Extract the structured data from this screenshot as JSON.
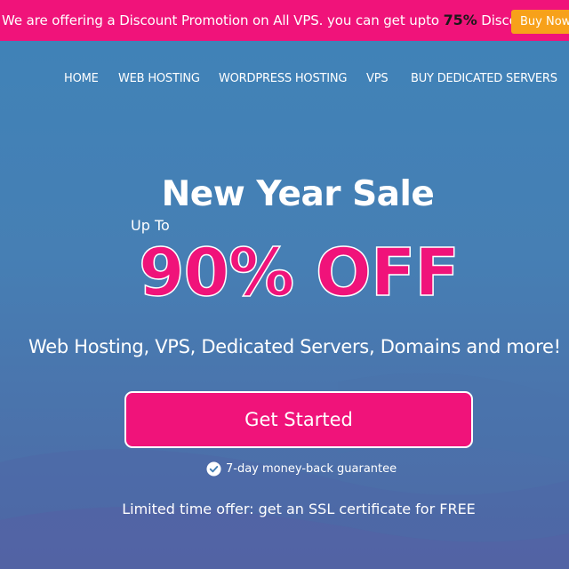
{
  "promo": {
    "text": "We are offering a Discount Promotion on All VPS. you can get upto ",
    "percent": "75%",
    "suffix": " Discount",
    "button_label": "Buy Now"
  },
  "nav": {
    "items": [
      {
        "label": "HOME"
      },
      {
        "label": "WEB HOSTING"
      },
      {
        "label": "WORDPRESS HOSTING"
      },
      {
        "label": "VPS"
      },
      {
        "label": "BUY DEDICATED SERVERS"
      }
    ]
  },
  "hero": {
    "title": "New Year Sale",
    "up_to": "Up To",
    "discount": "90% OFF",
    "subtitle": "Web Hosting, VPS, Dedicated Servers, Domains and more!",
    "cta_label": "Get Started",
    "guarantee": "7-day money-back guarantee",
    "ssl_offer": "Limited time offer: get an SSL certificate for FREE"
  },
  "colors": {
    "accent_pink": "#f0137a",
    "button_orange": "#f7a11a",
    "background_blue": "#437fb4"
  },
  "icons": {
    "guarantee_icon": "check-circle-icon"
  }
}
